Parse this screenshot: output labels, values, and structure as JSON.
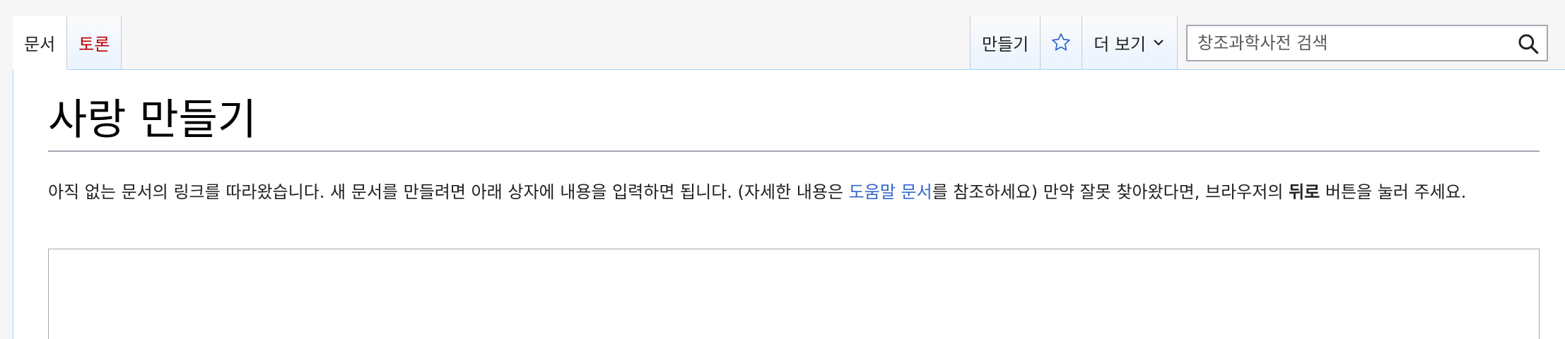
{
  "tabs_left": [
    {
      "label": "문서"
    },
    {
      "label": "토론"
    }
  ],
  "tabs_right": {
    "create_label": "만들기",
    "watch_icon": "star-icon",
    "more_label": "더 보기"
  },
  "search": {
    "placeholder": "창조과학사전 검색",
    "value": ""
  },
  "page": {
    "title": "사랑 만들기",
    "notice_part1": "아직 없는 문서의 링크를 따라왔습니다. 새 문서를 만들려면 아래 상자에 내용을 입력하면 됩니다. (자세한 내용은 ",
    "help_link": "도움말 문서",
    "notice_part2": "를 참조하세요) 만약 잘못 찾아왔다면, 브라우저의 ",
    "back_bold": "뒤로",
    "notice_part3": " 버튼을 눌러 주세요."
  },
  "colors": {
    "link": "#3366cc",
    "talk_red": "#ba0000",
    "tab_border": "#a7d7f9"
  }
}
